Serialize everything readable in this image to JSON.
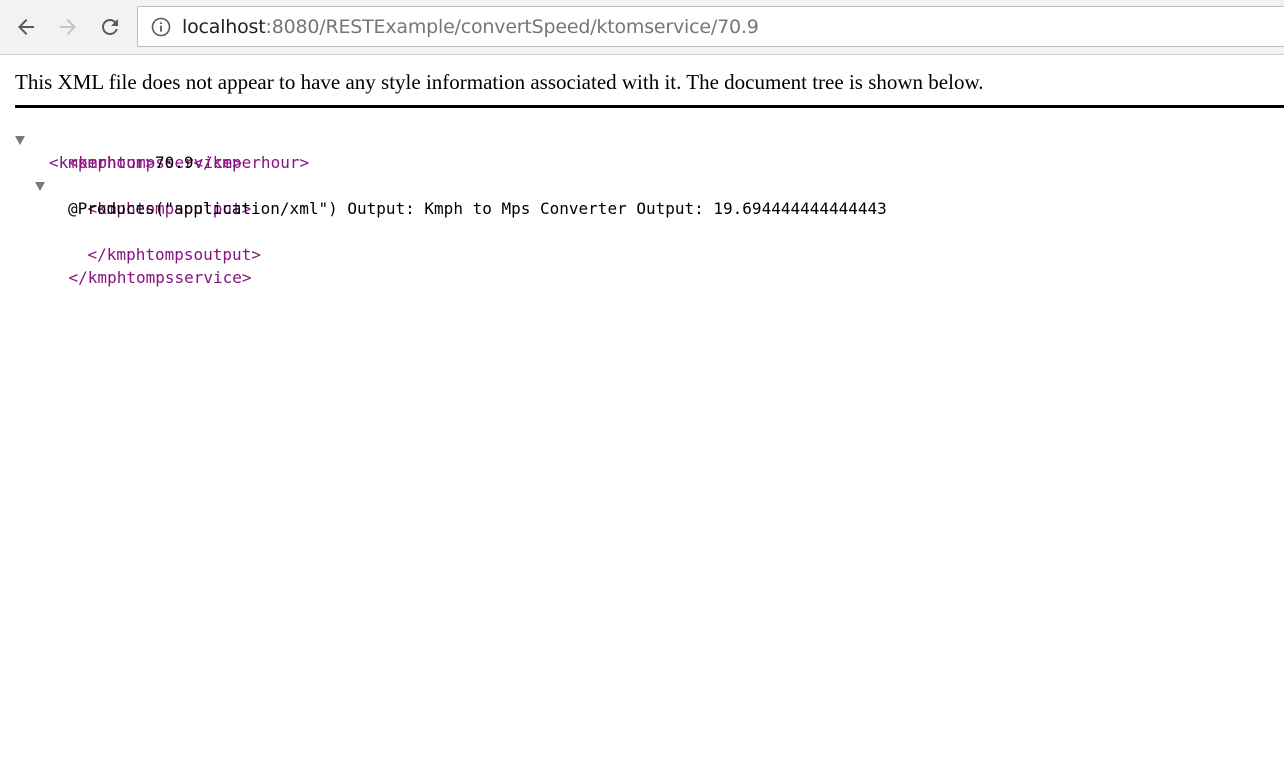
{
  "browser": {
    "url_host": "localhost",
    "url_path": ":8080/RESTExample/convertSpeed/ktomservice/70.9",
    "back_icon": "arrow-left-icon",
    "forward_icon": "arrow-right-icon",
    "reload_icon": "reload-icon",
    "info_icon": "info-circle-icon"
  },
  "notice": "This XML file does not appear to have any style information associated with it. The document tree is shown below.",
  "xml": {
    "root_open": "<kmphtompsservice>",
    "kmperhour_open": "<kmperhour>",
    "kmperhour_value": "70.9",
    "kmperhour_close": "</kmperhour>",
    "output_open": "<kmphtompsoutput>",
    "output_text": "@Produces(\"application/xml\") Output: Kmph to Mps Converter Output: 19.694444444444443",
    "output_close": "</kmphtompsoutput>",
    "root_close": "</kmphtompsservice>"
  },
  "colors": {
    "tag": "#881280",
    "text": "#000000",
    "toolbar": "#f2f2f2"
  }
}
